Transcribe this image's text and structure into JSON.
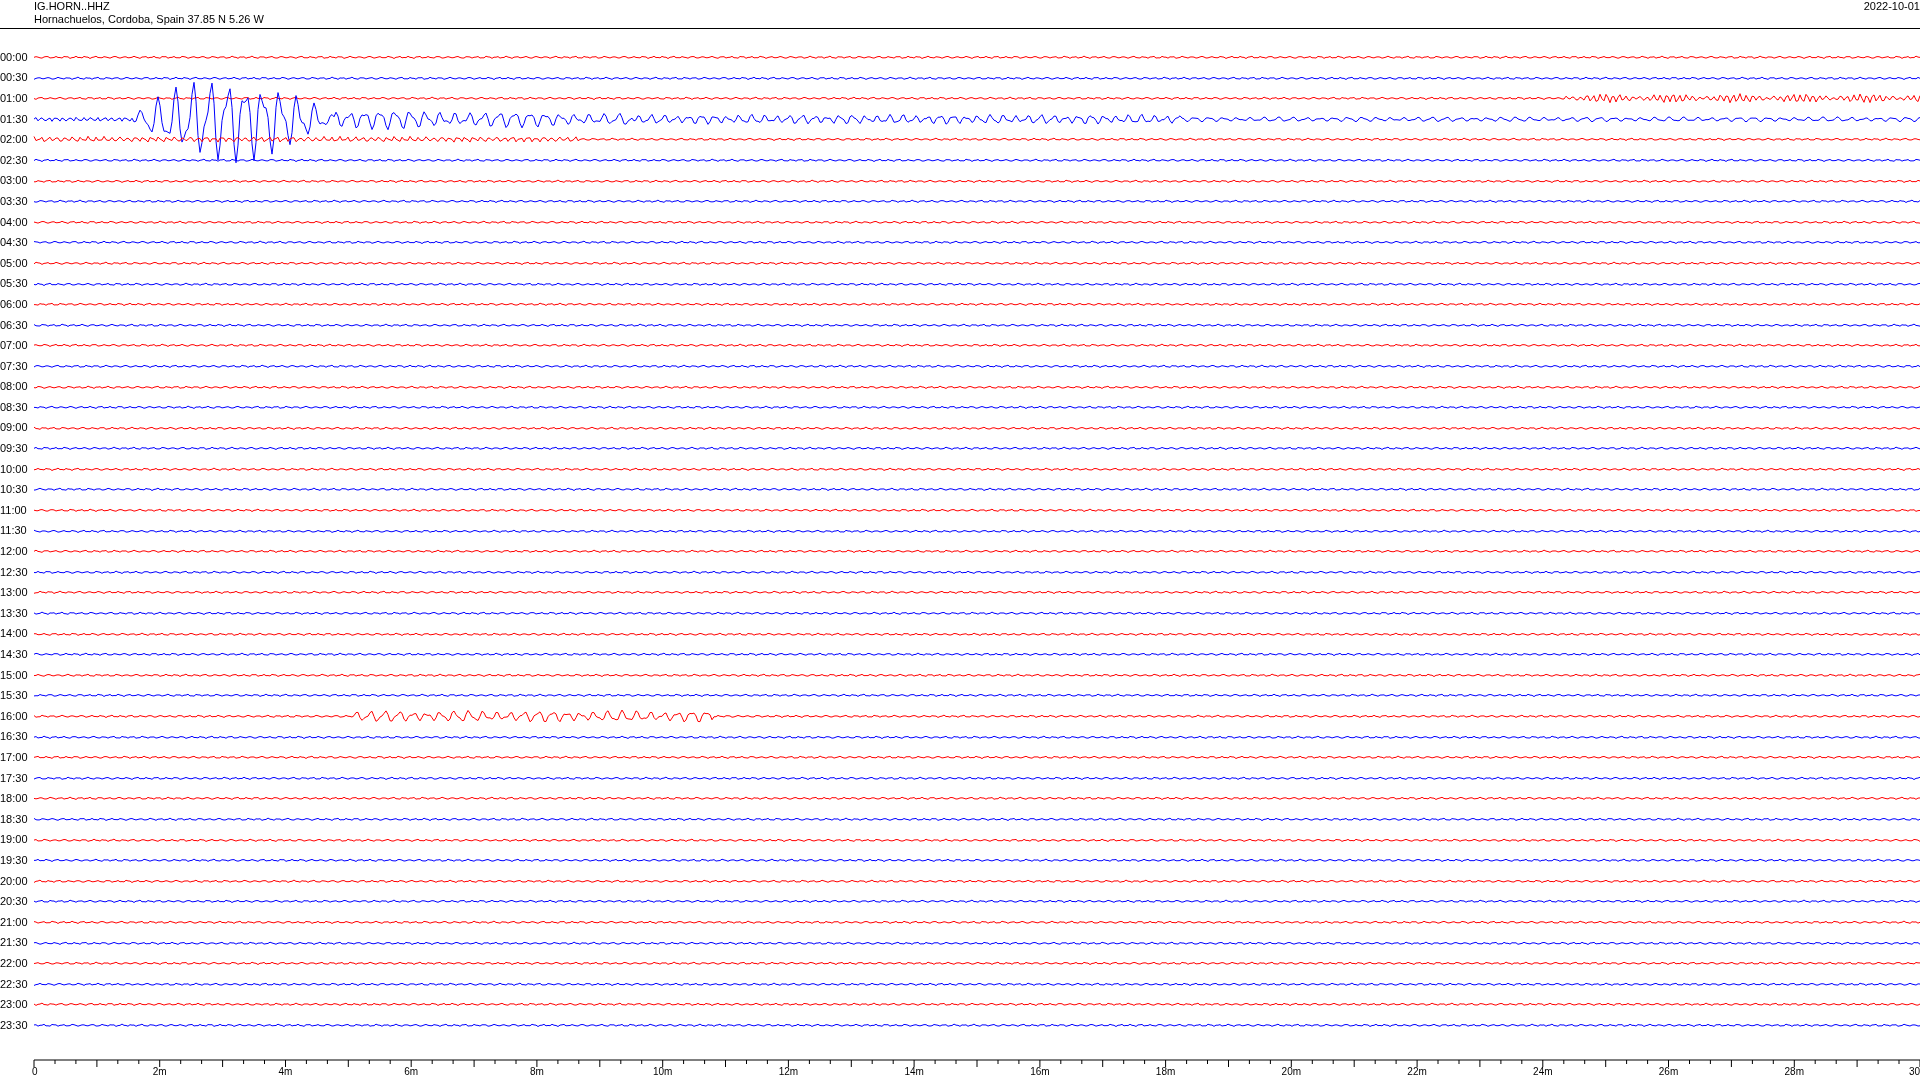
{
  "header": {
    "station": "IG.HORN..HHZ",
    "location": "Hornachuelos, Cordoba, Spain  37.85 N 5.26 W",
    "date": "2022-10-01"
  },
  "rows": [
    {
      "label": "00:00",
      "color": "#ff0000"
    },
    {
      "label": "00:30",
      "color": "#0000ff"
    },
    {
      "label": "01:00",
      "color": "#ff0000"
    },
    {
      "label": "01:30",
      "color": "#0000ff"
    },
    {
      "label": "02:00",
      "color": "#ff0000"
    },
    {
      "label": "02:30",
      "color": "#0000ff"
    },
    {
      "label": "03:00",
      "color": "#ff0000"
    },
    {
      "label": "03:30",
      "color": "#0000ff"
    },
    {
      "label": "04:00",
      "color": "#ff0000"
    },
    {
      "label": "04:30",
      "color": "#0000ff"
    },
    {
      "label": "05:00",
      "color": "#ff0000"
    },
    {
      "label": "05:30",
      "color": "#0000ff"
    },
    {
      "label": "06:00",
      "color": "#ff0000"
    },
    {
      "label": "06:30",
      "color": "#0000ff"
    },
    {
      "label": "07:00",
      "color": "#ff0000"
    },
    {
      "label": "07:30",
      "color": "#0000ff"
    },
    {
      "label": "08:00",
      "color": "#ff0000"
    },
    {
      "label": "08:30",
      "color": "#0000ff"
    },
    {
      "label": "09:00",
      "color": "#ff0000"
    },
    {
      "label": "09:30",
      "color": "#0000ff"
    },
    {
      "label": "10:00",
      "color": "#ff0000"
    },
    {
      "label": "10:30",
      "color": "#0000ff"
    },
    {
      "label": "11:00",
      "color": "#ff0000"
    },
    {
      "label": "11:30",
      "color": "#0000ff"
    },
    {
      "label": "12:00",
      "color": "#ff0000"
    },
    {
      "label": "12:30",
      "color": "#0000ff"
    },
    {
      "label": "13:00",
      "color": "#ff0000"
    },
    {
      "label": "13:30",
      "color": "#0000ff"
    },
    {
      "label": "14:00",
      "color": "#ff0000"
    },
    {
      "label": "14:30",
      "color": "#0000ff"
    },
    {
      "label": "15:00",
      "color": "#ff0000"
    },
    {
      "label": "15:30",
      "color": "#0000ff"
    },
    {
      "label": "16:00",
      "color": "#ff0000"
    },
    {
      "label": "16:30",
      "color": "#0000ff"
    },
    {
      "label": "17:00",
      "color": "#ff0000"
    },
    {
      "label": "17:30",
      "color": "#0000ff"
    },
    {
      "label": "18:00",
      "color": "#ff0000"
    },
    {
      "label": "18:30",
      "color": "#0000ff"
    },
    {
      "label": "19:00",
      "color": "#ff0000"
    },
    {
      "label": "19:30",
      "color": "#0000ff"
    },
    {
      "label": "20:00",
      "color": "#ff0000"
    },
    {
      "label": "20:30",
      "color": "#0000ff"
    },
    {
      "label": "21:00",
      "color": "#ff0000"
    },
    {
      "label": "21:30",
      "color": "#0000ff"
    },
    {
      "label": "22:00",
      "color": "#ff0000"
    },
    {
      "label": "22:30",
      "color": "#0000ff"
    },
    {
      "label": "23:00",
      "color": "#ff0000"
    },
    {
      "label": "23:30",
      "color": "#0000ff"
    }
  ],
  "time_axis": {
    "labels": [
      "0",
      "2m",
      "4m",
      "6m",
      "8m",
      "10m",
      "12m",
      "14m",
      "16m",
      "18m",
      "20m",
      "22m",
      "24m",
      "26m",
      "28m",
      "30"
    ]
  }
}
